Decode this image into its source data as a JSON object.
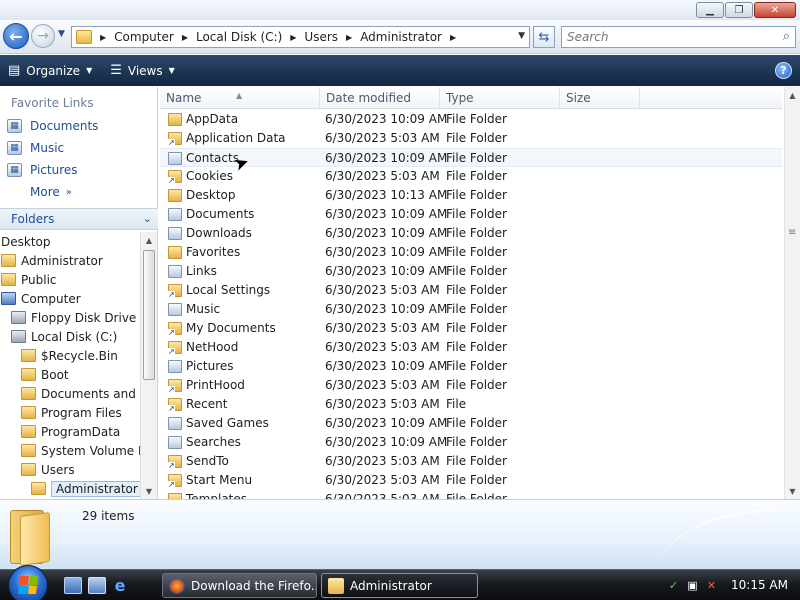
{
  "window": {
    "controls": {
      "minimize": "▁",
      "maximize": "❐",
      "close": "✕"
    }
  },
  "address": {
    "crumbs": [
      "Computer",
      "Local Disk (C:)",
      "Users",
      "Administrator"
    ],
    "search_placeholder": "Search"
  },
  "toolbar": {
    "organize_label": "Organize",
    "views_label": "Views",
    "help_label": "?"
  },
  "nav": {
    "favorites_header": "Favorite Links",
    "favorites": [
      {
        "label": "Documents",
        "icon": "documents-icon"
      },
      {
        "label": "Music",
        "icon": "music-icon"
      },
      {
        "label": "Pictures",
        "icon": "pictures-icon"
      }
    ],
    "more_label": "More",
    "folders_header": "Folders",
    "tree": [
      {
        "label": "Desktop",
        "indent": 0,
        "icon": "none"
      },
      {
        "label": "Administrator",
        "indent": 0,
        "icon": "folder"
      },
      {
        "label": "Public",
        "indent": 0,
        "icon": "folder"
      },
      {
        "label": "Computer",
        "indent": 0,
        "icon": "pc"
      },
      {
        "label": "Floppy Disk Drive (A:)",
        "indent": 1,
        "icon": "drive"
      },
      {
        "label": "Local Disk (C:)",
        "indent": 1,
        "icon": "drive"
      },
      {
        "label": "$Recycle.Bin",
        "indent": 2,
        "icon": "folder"
      },
      {
        "label": "Boot",
        "indent": 2,
        "icon": "folder"
      },
      {
        "label": "Documents and Settings",
        "indent": 2,
        "icon": "folder"
      },
      {
        "label": "Program Files",
        "indent": 2,
        "icon": "folder"
      },
      {
        "label": "ProgramData",
        "indent": 2,
        "icon": "folder"
      },
      {
        "label": "System Volume Information",
        "indent": 2,
        "icon": "folder"
      },
      {
        "label": "Users",
        "indent": 2,
        "icon": "folder"
      },
      {
        "label": "Administrator",
        "indent": 3,
        "icon": "folder",
        "selected": true
      }
    ]
  },
  "filelist": {
    "columns": [
      "Name",
      "Date modified",
      "Type",
      "Size"
    ],
    "rows": [
      {
        "name": "AppData",
        "date": "6/30/2023 10:09 AM",
        "type": "File Folder",
        "icon": "folder"
      },
      {
        "name": "Application Data",
        "date": "6/30/2023 5:03 AM",
        "type": "File Folder",
        "icon": "shortcut"
      },
      {
        "name": "Contacts",
        "date": "6/30/2023 10:09 AM",
        "type": "File Folder",
        "icon": "doc"
      },
      {
        "name": "Cookies",
        "date": "6/30/2023 5:03 AM",
        "type": "File Folder",
        "icon": "shortcut"
      },
      {
        "name": "Desktop",
        "date": "6/30/2023 10:13 AM",
        "type": "File Folder",
        "icon": "folder"
      },
      {
        "name": "Documents",
        "date": "6/30/2023 10:09 AM",
        "type": "File Folder",
        "icon": "doc"
      },
      {
        "name": "Downloads",
        "date": "6/30/2023 10:09 AM",
        "type": "File Folder",
        "icon": "doc"
      },
      {
        "name": "Favorites",
        "date": "6/30/2023 10:09 AM",
        "type": "File Folder",
        "icon": "folder"
      },
      {
        "name": "Links",
        "date": "6/30/2023 10:09 AM",
        "type": "File Folder",
        "icon": "doc"
      },
      {
        "name": "Local Settings",
        "date": "6/30/2023 5:03 AM",
        "type": "File Folder",
        "icon": "shortcut"
      },
      {
        "name": "Music",
        "date": "6/30/2023 10:09 AM",
        "type": "File Folder",
        "icon": "doc"
      },
      {
        "name": "My Documents",
        "date": "6/30/2023 5:03 AM",
        "type": "File Folder",
        "icon": "shortcut"
      },
      {
        "name": "NetHood",
        "date": "6/30/2023 5:03 AM",
        "type": "File Folder",
        "icon": "shortcut"
      },
      {
        "name": "Pictures",
        "date": "6/30/2023 10:09 AM",
        "type": "File Folder",
        "icon": "doc"
      },
      {
        "name": "PrintHood",
        "date": "6/30/2023 5:03 AM",
        "type": "File Folder",
        "icon": "shortcut"
      },
      {
        "name": "Recent",
        "date": "6/30/2023 5:03 AM",
        "type": "File",
        "icon": "shortcut"
      },
      {
        "name": "Saved Games",
        "date": "6/30/2023 10:09 AM",
        "type": "File Folder",
        "icon": "doc"
      },
      {
        "name": "Searches",
        "date": "6/30/2023 10:09 AM",
        "type": "File Folder",
        "icon": "doc"
      },
      {
        "name": "SendTo",
        "date": "6/30/2023 5:03 AM",
        "type": "File Folder",
        "icon": "shortcut"
      },
      {
        "name": "Start Menu",
        "date": "6/30/2023 5:03 AM",
        "type": "File Folder",
        "icon": "shortcut"
      },
      {
        "name": "Templates",
        "date": "6/30/2023 5:03 AM",
        "type": "File Folder",
        "icon": "shortcut"
      }
    ]
  },
  "details": {
    "item_count": "29 items"
  },
  "taskbar": {
    "buttons": [
      {
        "label": "Download the Firefo...",
        "icon": "firefox-icon",
        "active": false
      },
      {
        "label": "Administrator",
        "icon": "folder-icon",
        "active": true
      }
    ],
    "clock": "10:15 AM"
  },
  "colors": {
    "accent": "#1f4e96",
    "cmdbar": "#1e3756",
    "folder": "#e3b346",
    "tray_alert": "#e23c2c"
  }
}
